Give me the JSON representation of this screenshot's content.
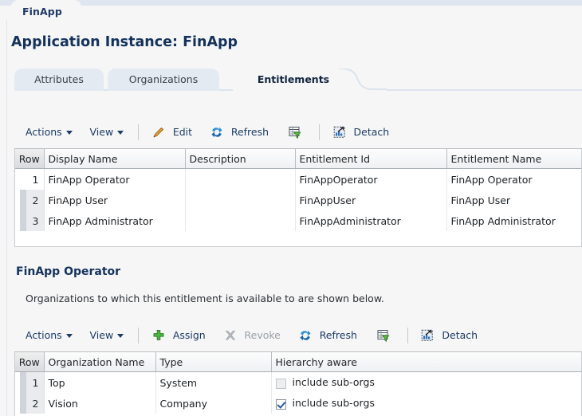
{
  "app": {
    "breadcrumb_tab": "FinApp",
    "page_title": "Application Instance: FinApp"
  },
  "tabs": [
    {
      "label": "Attributes",
      "active": false
    },
    {
      "label": "Organizations",
      "active": false
    },
    {
      "label": "Entitlements",
      "active": true
    }
  ],
  "entitlements_toolbar": {
    "actions_label": "Actions",
    "view_label": "View",
    "edit_label": "Edit",
    "refresh_label": "Refresh",
    "query_icon": "query-by-example-icon",
    "detach_label": "Detach"
  },
  "entitlements_table": {
    "columns": [
      "Row",
      "Display Name",
      "Description",
      "Entitlement Id",
      "Entitlement Name"
    ],
    "rows": [
      {
        "row": "1",
        "display_name": "FinApp Operator",
        "description": "",
        "entitlement_id": "FinAppOperator",
        "entitlement_name": "FinApp Operator",
        "selected": true
      },
      {
        "row": "2",
        "display_name": "FinApp User",
        "description": "",
        "entitlement_id": "FinAppUser",
        "entitlement_name": "FinApp User",
        "selected": false
      },
      {
        "row": "3",
        "display_name": "FinApp Administrator",
        "description": "",
        "entitlement_id": "FinAppAdministrator",
        "entitlement_name": "FinApp Administrator",
        "selected": false
      }
    ]
  },
  "detail_section": {
    "title": "FinApp Operator",
    "description": "Organizations to which this entitlement is available to are shown below."
  },
  "organizations_toolbar": {
    "actions_label": "Actions",
    "view_label": "View",
    "assign_label": "Assign",
    "revoke_label": "Revoke",
    "revoke_disabled": true,
    "refresh_label": "Refresh",
    "query_icon": "query-by-example-icon",
    "detach_label": "Detach"
  },
  "organizations_table": {
    "columns": [
      "Row",
      "Organization Name",
      "Type",
      "Hierarchy aware"
    ],
    "rows": [
      {
        "row": "1",
        "organization_name": "Top",
        "type": "System",
        "hierarchy_checked": false,
        "hierarchy_label": "include sub-orgs"
      },
      {
        "row": "2",
        "organization_name": "Vision",
        "type": "Company",
        "hierarchy_checked": true,
        "hierarchy_label": "include sub-orgs"
      }
    ]
  },
  "colors": {
    "title_blue": "#14325c",
    "link_blue": "#1b3a66",
    "tab_inactive": "#e4eaf2",
    "page_bg": "#f6f6f7",
    "top_band": "#dfe6ef",
    "check_blue": "#2a59a8"
  }
}
